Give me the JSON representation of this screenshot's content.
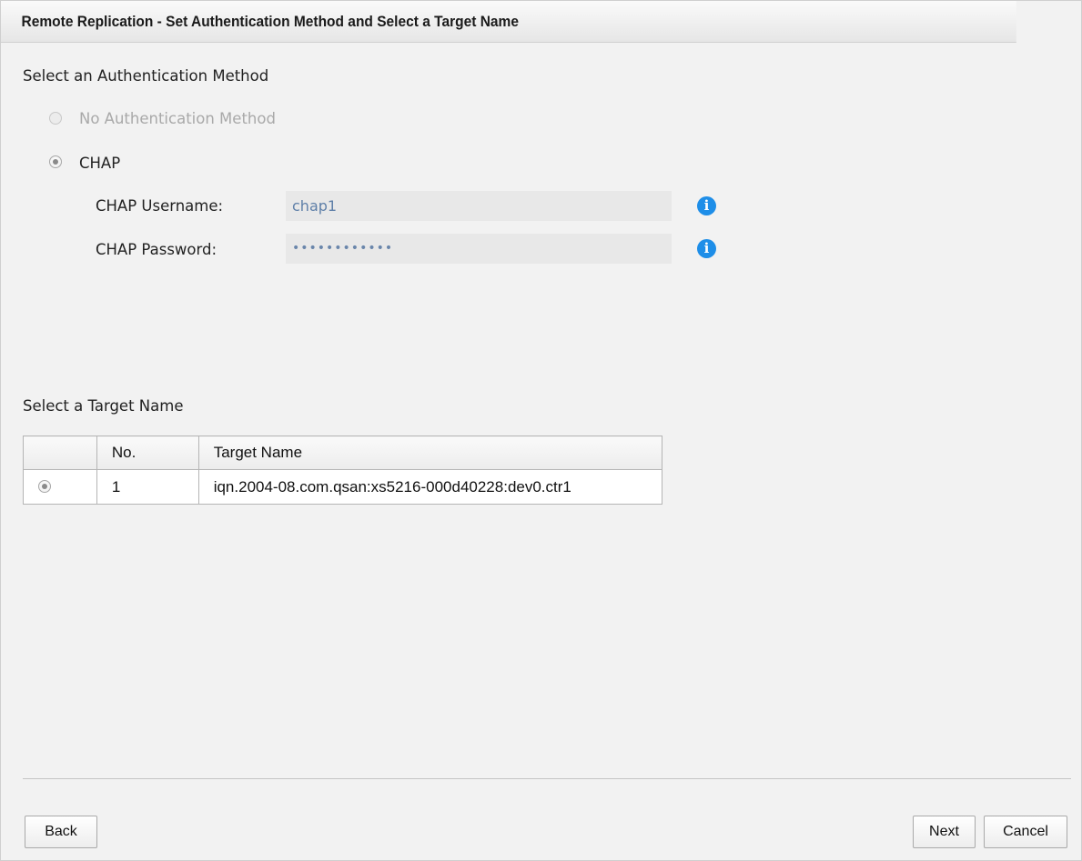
{
  "dialog": {
    "title": "Remote Replication - Set Authentication Method and Select a Target Name"
  },
  "auth": {
    "heading": "Select an Authentication Method",
    "options": [
      {
        "label": "No Authentication Method",
        "disabled": true,
        "selected": false
      },
      {
        "label": "CHAP",
        "disabled": false,
        "selected": true
      }
    ],
    "username_label": "CHAP Username:",
    "username_value": "chap1",
    "password_label": "CHAP Password:",
    "password_value": "••••••••••••",
    "info_icon": "i"
  },
  "target": {
    "heading": "Select a Target Name",
    "columns": [
      "",
      "No.",
      "Target Name"
    ],
    "rows": [
      {
        "no": "1",
        "name": "iqn.2004-08.com.qsan:xs5216-000d40228:dev0.ctr1",
        "selected": true
      }
    ]
  },
  "buttons": {
    "back": "Back",
    "next": "Next",
    "cancel": "Cancel"
  },
  "colors": {
    "info_icon": "#1e8ee8",
    "field_text": "#5e7fa8"
  }
}
